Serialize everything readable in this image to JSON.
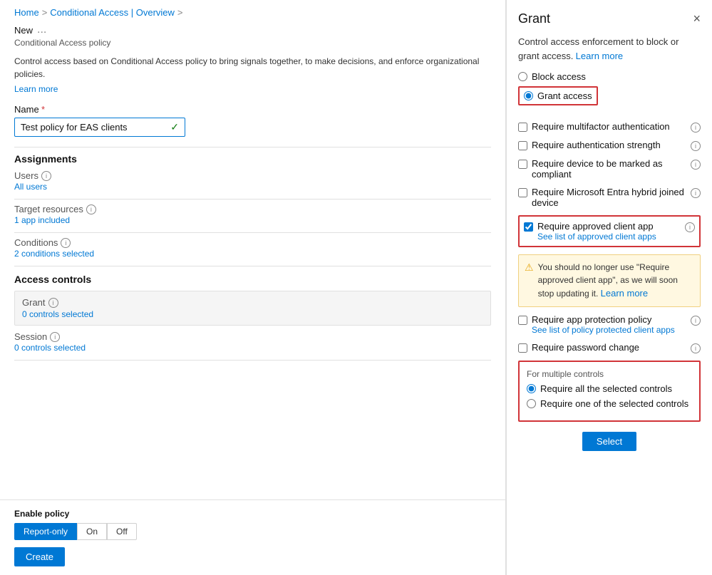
{
  "breadcrumb": {
    "home": "Home",
    "sep1": ">",
    "conditional_access": "Conditional Access | Overview",
    "sep2": ">"
  },
  "page": {
    "title": "New",
    "dots": "...",
    "subtitle": "Conditional Access policy"
  },
  "description": {
    "text": "Control access based on Conditional Access policy to bring signals together, to make decisions, and enforce organizational policies.",
    "learn_more": "Learn more"
  },
  "name_field": {
    "label": "Name",
    "required_marker": "*",
    "value": "Test policy for EAS clients"
  },
  "assignments": {
    "title": "Assignments",
    "users": {
      "label": "Users",
      "value": "All users"
    },
    "target_resources": {
      "label": "Target resources",
      "value": "1 app included"
    },
    "conditions": {
      "label": "Conditions",
      "value": "2 conditions selected"
    }
  },
  "access_controls": {
    "title": "Access controls",
    "grant": {
      "label": "Grant",
      "value": "0 controls selected"
    },
    "session": {
      "label": "Session",
      "value": "0 controls selected"
    }
  },
  "enable_policy": {
    "label": "Enable policy",
    "options": [
      "Report-only",
      "On",
      "Off"
    ],
    "active": "Report-only"
  },
  "create_btn": "Create",
  "grant_panel": {
    "title": "Grant",
    "close_label": "×",
    "description": "Control access enforcement to block or grant access.",
    "learn_more": "Learn more",
    "block_access": "Block access",
    "grant_access": "Grant access",
    "checkboxes": [
      {
        "id": "mfa",
        "label": "Require multifactor authentication",
        "sublabel": "",
        "checked": false,
        "in_red_box": false
      },
      {
        "id": "auth_strength",
        "label": "Require authentication strength",
        "sublabel": "",
        "checked": false,
        "in_red_box": false
      },
      {
        "id": "compliant",
        "label": "Require device to be marked as compliant",
        "sublabel": "",
        "checked": false,
        "in_red_box": false
      },
      {
        "id": "hybrid",
        "label": "Require Microsoft Entra hybrid joined device",
        "sublabel": "",
        "checked": false,
        "in_red_box": false
      },
      {
        "id": "approved_client",
        "label": "Require approved client app",
        "sublabel": "See list of approved client apps",
        "checked": true,
        "in_red_box": true
      }
    ],
    "warning": {
      "text": "You should no longer use \"Require approved client app\", as we will soon stop updating it.",
      "learn_more": "Learn more"
    },
    "more_checkboxes": [
      {
        "id": "app_protection",
        "label": "Require app protection policy",
        "sublabel": "See list of policy protected client apps",
        "checked": false
      },
      {
        "id": "password_change",
        "label": "Require password change",
        "sublabel": "",
        "checked": false
      }
    ],
    "multiple_controls": {
      "title": "For multiple controls",
      "options": [
        "Require all the selected controls",
        "Require one of the selected controls"
      ],
      "selected": "Require all the selected controls"
    },
    "select_btn": "Select"
  }
}
